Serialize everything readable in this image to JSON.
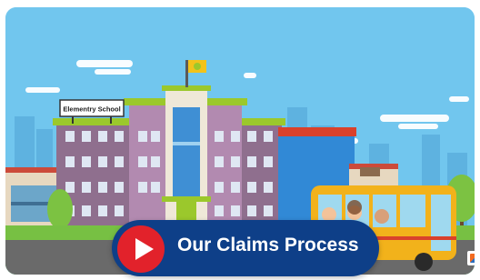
{
  "video": {
    "sign_text": "Elementry School",
    "play_label": "Our Claims Process"
  },
  "colors": {
    "sky": "#71c6ee",
    "pill": "#0e3f88",
    "play": "#e2222b",
    "school_wall": "#8a6a8a",
    "bus": "#f2b21b"
  },
  "icons": {
    "play": "play-icon",
    "logo": "brand-logo-icon"
  }
}
